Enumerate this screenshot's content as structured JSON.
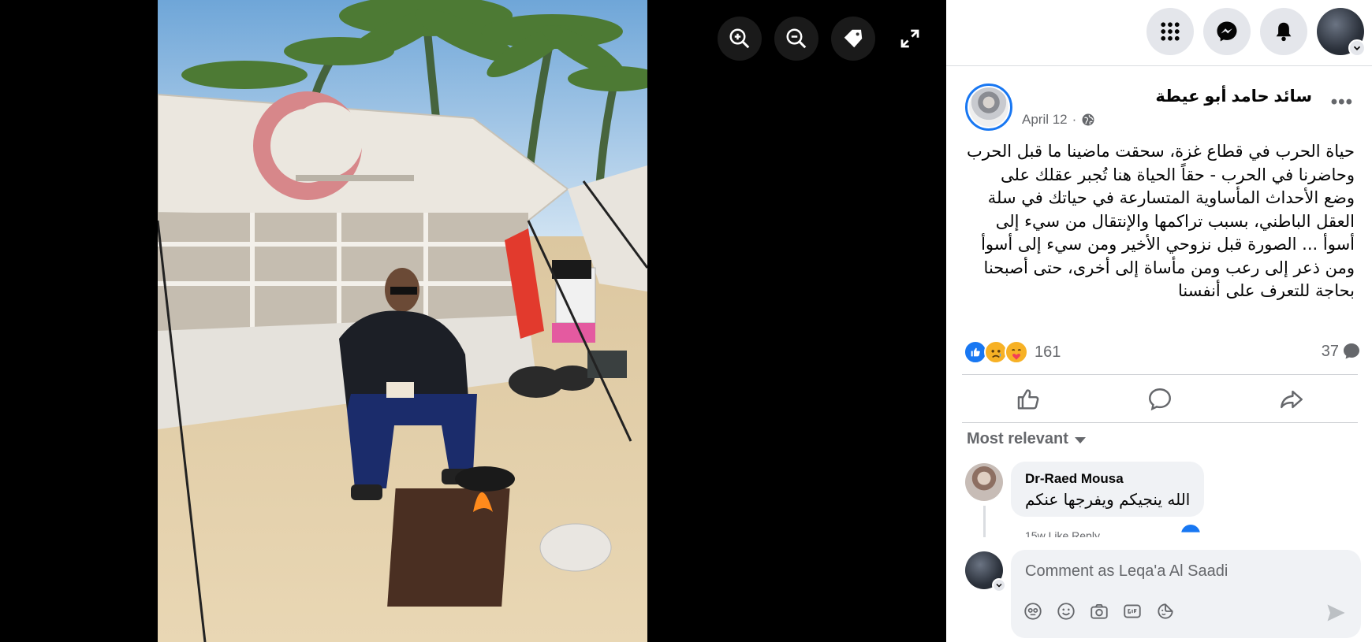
{
  "viewer": {
    "tools": [
      "zoom-in-icon",
      "zoom-out-icon",
      "tag-icon",
      "fullscreen-icon"
    ]
  },
  "topbar": {
    "icons": [
      "menu-grid-icon",
      "messenger-icon",
      "notifications-bell-icon",
      "account-avatar"
    ]
  },
  "post": {
    "author": "سائد حامد أبو عيطة",
    "date": "April 12",
    "separator": "·",
    "text": "حياة الحرب في قطاع غزة، سحقت ماضينا ما قبل الحرب وحاضرنا في الحرب - حقاً الحياة هنا تُجبر عقلك على وضع الأحداث المأساوية المتسارعة في حياتك في سلة العقل الباطني، بسبب تراكمها والإنتقال من سيء إلى أسوأ ... الصورة قبل نزوحي الأخير ومن سيء إلى أسوأ ومن ذعر إلى رعب ومن مأساة إلى أخرى، حتى أصبحنا بحاجة للتعرف على أنفسنا",
    "reaction_count": "161",
    "comment_count": "37"
  },
  "comments": {
    "sort_label": "Most relevant",
    "items": [
      {
        "name": "Dr-Raed Mousa",
        "text": "الله ينجيكم ويفرجها عنكم",
        "footer": "15w   Like   Reply"
      }
    ]
  },
  "composer": {
    "placeholder": "Comment as Leqa'a Al Saadi"
  },
  "colors": {
    "accent": "#1877f2",
    "panel_bg": "#ffffff",
    "bubble_bg": "#f0f2f5",
    "secondary_text": "#65676b"
  }
}
